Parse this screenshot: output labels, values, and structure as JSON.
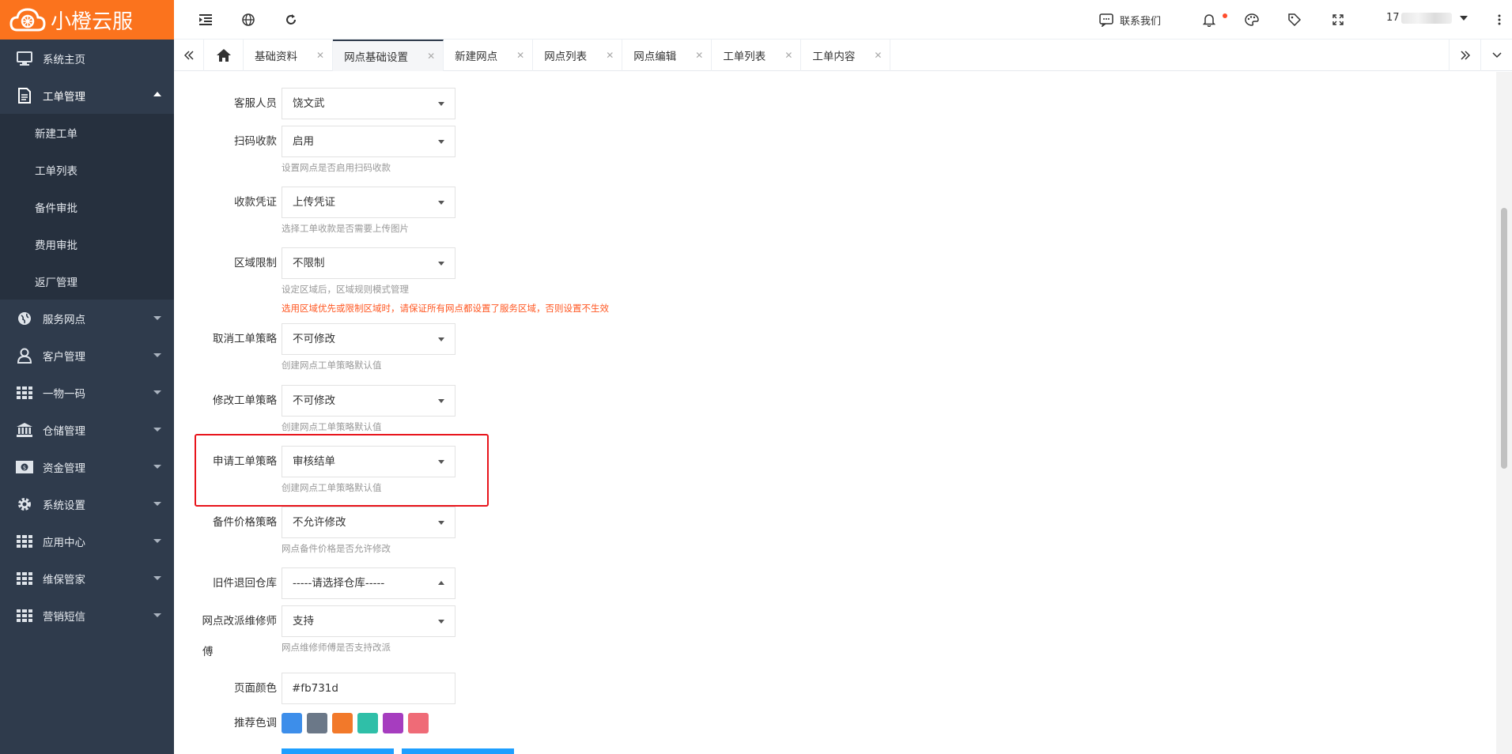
{
  "app": {
    "logo_text": "小橙云服",
    "accent": "#fb731d"
  },
  "sidebar": {
    "items": [
      {
        "label": "系统主页",
        "icon": "monitor-icon"
      },
      {
        "label": "工单管理",
        "icon": "document-icon",
        "expanded": true,
        "children": [
          "新建工单",
          "工单列表",
          "备件审批",
          "费用审批",
          "返厂管理"
        ]
      },
      {
        "label": "服务网点",
        "icon": "globe-icon"
      },
      {
        "label": "客户管理",
        "icon": "user-icon"
      },
      {
        "label": "一物一码",
        "icon": "grid-icon"
      },
      {
        "label": "仓储管理",
        "icon": "bank-icon"
      },
      {
        "label": "资金管理",
        "icon": "money-icon"
      },
      {
        "label": "系统设置",
        "icon": "gear-icon"
      },
      {
        "label": "应用中心",
        "icon": "grid-icon"
      },
      {
        "label": "维保管家",
        "icon": "grid-icon"
      },
      {
        "label": "营销短信",
        "icon": "grid-icon"
      }
    ]
  },
  "topbar": {
    "contact_label": "联系我们",
    "user_prefix": "17"
  },
  "tabs": [
    {
      "label": "基础资料"
    },
    {
      "label": "网点基础设置",
      "active": true
    },
    {
      "label": "新建网点"
    },
    {
      "label": "网点列表"
    },
    {
      "label": "网点编辑"
    },
    {
      "label": "工单列表"
    },
    {
      "label": "工单内容"
    }
  ],
  "form": {
    "customer_service": {
      "label": "客服人员",
      "value": "饶文武"
    },
    "scan_payment": {
      "label": "扫码收款",
      "value": "启用",
      "hint": "设置网点是否启用扫码收款"
    },
    "payment_voucher": {
      "label": "收款凭证",
      "value": "上传凭证",
      "hint": "选择工单收款是否需要上传图片"
    },
    "region_limit": {
      "label": "区域限制",
      "value": "不限制",
      "hint": "设定区域后，区域规则模式管理",
      "warning": "选用区域优先或限制区域时，请保证所有网点都设置了服务区域，否则设置不生效"
    },
    "cancel_policy": {
      "label": "取消工单策略",
      "value": "不可修改",
      "hint": "创建网点工单策略默认值"
    },
    "modify_policy": {
      "label": "修改工单策略",
      "value": "不可修改",
      "hint": "创建网点工单策略默认值"
    },
    "apply_policy": {
      "label": "申请工单策略",
      "value": "审核结单",
      "hint": "创建网点工单策略默认值"
    },
    "parts_price": {
      "label": "备件价格策略",
      "value": "不允许修改",
      "hint": "网点备件价格是否允许修改"
    },
    "return_warehouse": {
      "label": "旧件退回仓库",
      "value": "-----请选择仓库-----"
    },
    "reassign": {
      "label_line1": "网点改派维修师",
      "label_line2": "傅",
      "value": "支持",
      "hint": "网点维修师傅是否支持改派"
    },
    "page_color": {
      "label": "页面颜色",
      "value": "#fb731d"
    },
    "recommended": {
      "label": "推荐色调",
      "colors": [
        "#3d8eea",
        "#6b7888",
        "#f2792a",
        "#2fbfa8",
        "#a63dbf",
        "#ef6b77"
      ]
    }
  }
}
